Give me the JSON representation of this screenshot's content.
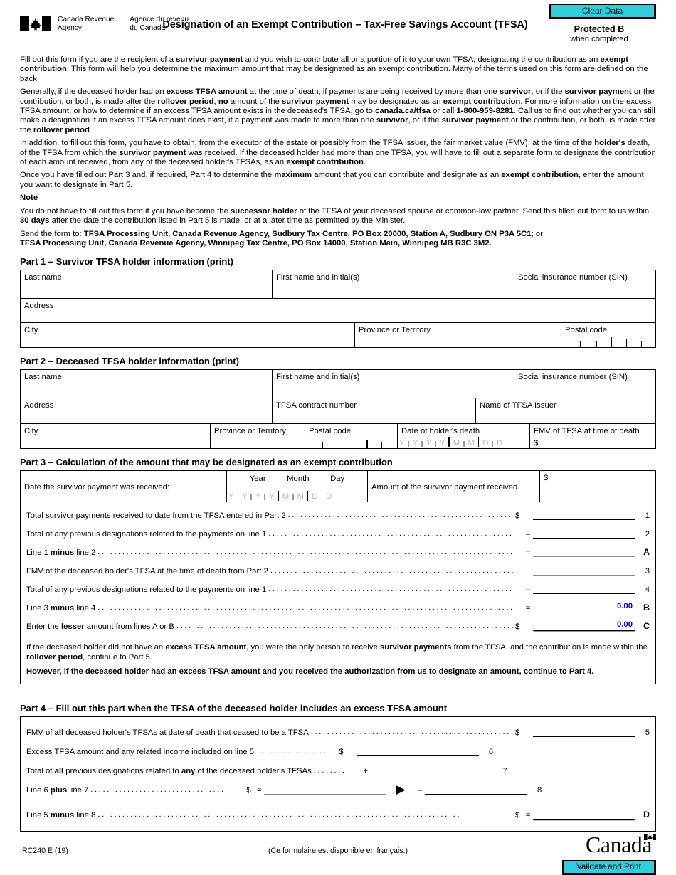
{
  "header": {
    "agency_en": "Canada Revenue\nAgency",
    "agency_fr": "Agence du revenu\ndu Canada",
    "title": "Designation of an Exempt Contribution – Tax-Free Savings Account (TFSA)",
    "clear_data_label": "Clear Data",
    "protected_b": "Protected B",
    "when_completed": "when completed"
  },
  "intro": {
    "p1_a": "Fill out this form if you are the recipient of a ",
    "p1_b": "survivor payment",
    "p1_c": " and you wish to contribute all or a portion of it to your own TFSA, designating the contribution as an ",
    "p1_d": "exempt contribution",
    "p1_e": ". This form will help you determine the maximum amount that may be designated as an exempt contribution. Many of the terms used on this form are defined on the back.",
    "p2_full": "Generally, if the deceased holder had an excess TFSA amount at the time of death, if payments are being received by more than one survivor, or if the survivor payment or the contribution, or both, is made after the rollover period, no amount of the survivor payment may be designated as an exempt contribution. For more information on the excess TFSA amount, or how to determine if an excess TFSA amount exists in the deceased's TFSA, go to canada.ca/tfsa or call 1-800-959-8281. Call us to find out whether you can still make a designation if an excess TFSA amount does exist, if a payment was made to more than one survivor, or if the survivor payment or the contribution, or both, is made after the rollover period.",
    "p3_full": "In addition, to fill out this form, you have to obtain, from the executor of the estate or possibly from the TFSA issuer, the fair market value (FMV), at the time of the holder's death, of the TFSA from which the survivor payment was received. If the deceased holder had more than one TFSA, you will have to fill out a separate form to designate the contribution of each amount received, from any of the deceased holder's TFSAs, as an exempt contribution.",
    "p4_full": "Once you have filled out Part 3 and, if required, Part 4 to determine the maximum amount that you can contribute and designate as an exempt contribution, enter the amount you want to designate in Part 5.",
    "note_heading": "Note",
    "note_body": "You do not have to fill out this form if you have become the successor holder of the TFSA of your deceased spouse or common-law partner. Send this filled out form to us within 30 days after the date the contribution listed in Part 5 is made, or at a later time as permitted by the Minister.",
    "send_label": "Send the form to: ",
    "send_addr1": "TFSA Processing Unit, Canada Revenue Agency, Sudbury Tax Centre, PO Box 20000, Station A, Sudbury ON  P3A 5C1",
    "send_addr1_tail": "; or",
    "send_addr2": "TFSA Processing Unit, Canada Revenue Agency, Winnipeg Tax Centre, PO Box 14000, Station Main, Winnipeg MB  R3C 3M2."
  },
  "part1": {
    "heading": "Part 1 – Survivor TFSA holder information (print)",
    "last_name": "Last name",
    "first_name": "First name and initial(s)",
    "sin": "Social insurance number (SIN)",
    "address": "Address",
    "city": "City",
    "province": "Province or Territory",
    "postal_code": "Postal code"
  },
  "part2": {
    "heading": "Part 2 – Deceased TFSA holder information (print)",
    "last_name": "Last name",
    "first_name": "First name and initial(s)",
    "sin": "Social insurance number (SIN)",
    "address": "Address",
    "contract_number": "TFSA contract number",
    "issuer_name": "Name of TFSA Issuer",
    "city": "City",
    "province": "Province or Territory",
    "postal_code": "Postal code",
    "date_of_death": "Date of holder's death",
    "fmv": "FMV of TFSA at time of death",
    "dollar": "$"
  },
  "part3": {
    "heading": "Part 3 – Calculation of the amount that may be designated as an exempt contribution",
    "date_label": "Date the survivor payment was received:",
    "year": "Year",
    "month": "Month",
    "day": "Day",
    "amount_label": "Amount of the survivor payment received.",
    "dollar": "$",
    "lines": [
      {
        "text": "Total survivor payments received to date from the TFSA entered in Part 2",
        "dollar": "$",
        "op": "",
        "value": "",
        "no": "1"
      },
      {
        "text": "Total of any previous designations related to the payments on line 1",
        "dollar": "",
        "op": "–",
        "value": "",
        "no": "2"
      },
      {
        "text_a": "Line 1 ",
        "text_b": "minus",
        "text_c": " line 2",
        "dollar": "",
        "op": "=",
        "value": "",
        "no": "A"
      },
      {
        "text": "FMV of the deceased holder's TFSA at the time of death from Part 2",
        "dollar": "",
        "op": "",
        "value": "",
        "no": "3"
      },
      {
        "text": "Total of any previous designations related to the payments on line 1",
        "dollar": "",
        "op": "–",
        "value": "",
        "no": "4"
      },
      {
        "text_a": "Line 3 ",
        "text_b": "minus",
        "text_c": " line 4",
        "dollar": "",
        "op": "=",
        "value": "0.00",
        "no": "B"
      },
      {
        "text_a": "Enter the ",
        "text_b": "lesser",
        "text_c": " amount from lines A or B",
        "dollar": "$",
        "op": "",
        "value": "0.00",
        "no": "C"
      }
    ],
    "note1_full": "If the deceased holder did not have an excess TFSA amount, you were the only person to receive survivor payments from the TFSA, and the contribution is made within the rollover period, continue to Part 5.",
    "note2_full": "However, if the deceased holder had an excess TFSA amount and you received the authorization from us to designate an amount, continue to Part 4."
  },
  "part4": {
    "heading": "Part 4 – Fill out this part when the TFSA of the deceased holder includes an excess TFSA amount",
    "line5_a": "FMV of ",
    "line5_b": "all",
    "line5_c": " deceased holder's TFSAs at date of death that ceased to be a TFSA",
    "line5_dollar": "$",
    "line5_no": "5",
    "line5_value": "",
    "line6_text": "Excess TFSA amount and any related income included on line 5.",
    "line6_dollar": "$",
    "line6_no": "6",
    "line6_value": "",
    "line7_a": "Total of ",
    "line7_b": "all",
    "line7_c": " previous designations related to ",
    "line7_d": "any",
    "line7_e": " of the deceased holder's TFSAs",
    "line7_op": "+",
    "line7_no": "7",
    "line7_value": "",
    "line8_a": "Line 6 ",
    "line8_b": "plus",
    "line8_c": " line 7",
    "line8_dollar": "$",
    "line8_op_left": "=",
    "line8_value_left": "",
    "line8_arrow": "▶",
    "line8_op_right": "–",
    "line8_no": "8",
    "line8_value_right": "",
    "lineD_a": "Line 5 ",
    "lineD_b": "minus",
    "lineD_c": " line 8",
    "lineD_dollar": "$",
    "lineD_op": "=",
    "lineD_no": "D",
    "lineD_value": ""
  },
  "footer": {
    "form_code": "RC240 E (19)",
    "french_note": "(Ce formulaire est disponible en français.)",
    "wordmark": "Canada",
    "validate_label": "Validate and Print"
  },
  "colors": {
    "button_cyan": "#33CCDD",
    "field_value_blue": "#0000c8",
    "gray_placeholder": "#b9b9b9"
  }
}
